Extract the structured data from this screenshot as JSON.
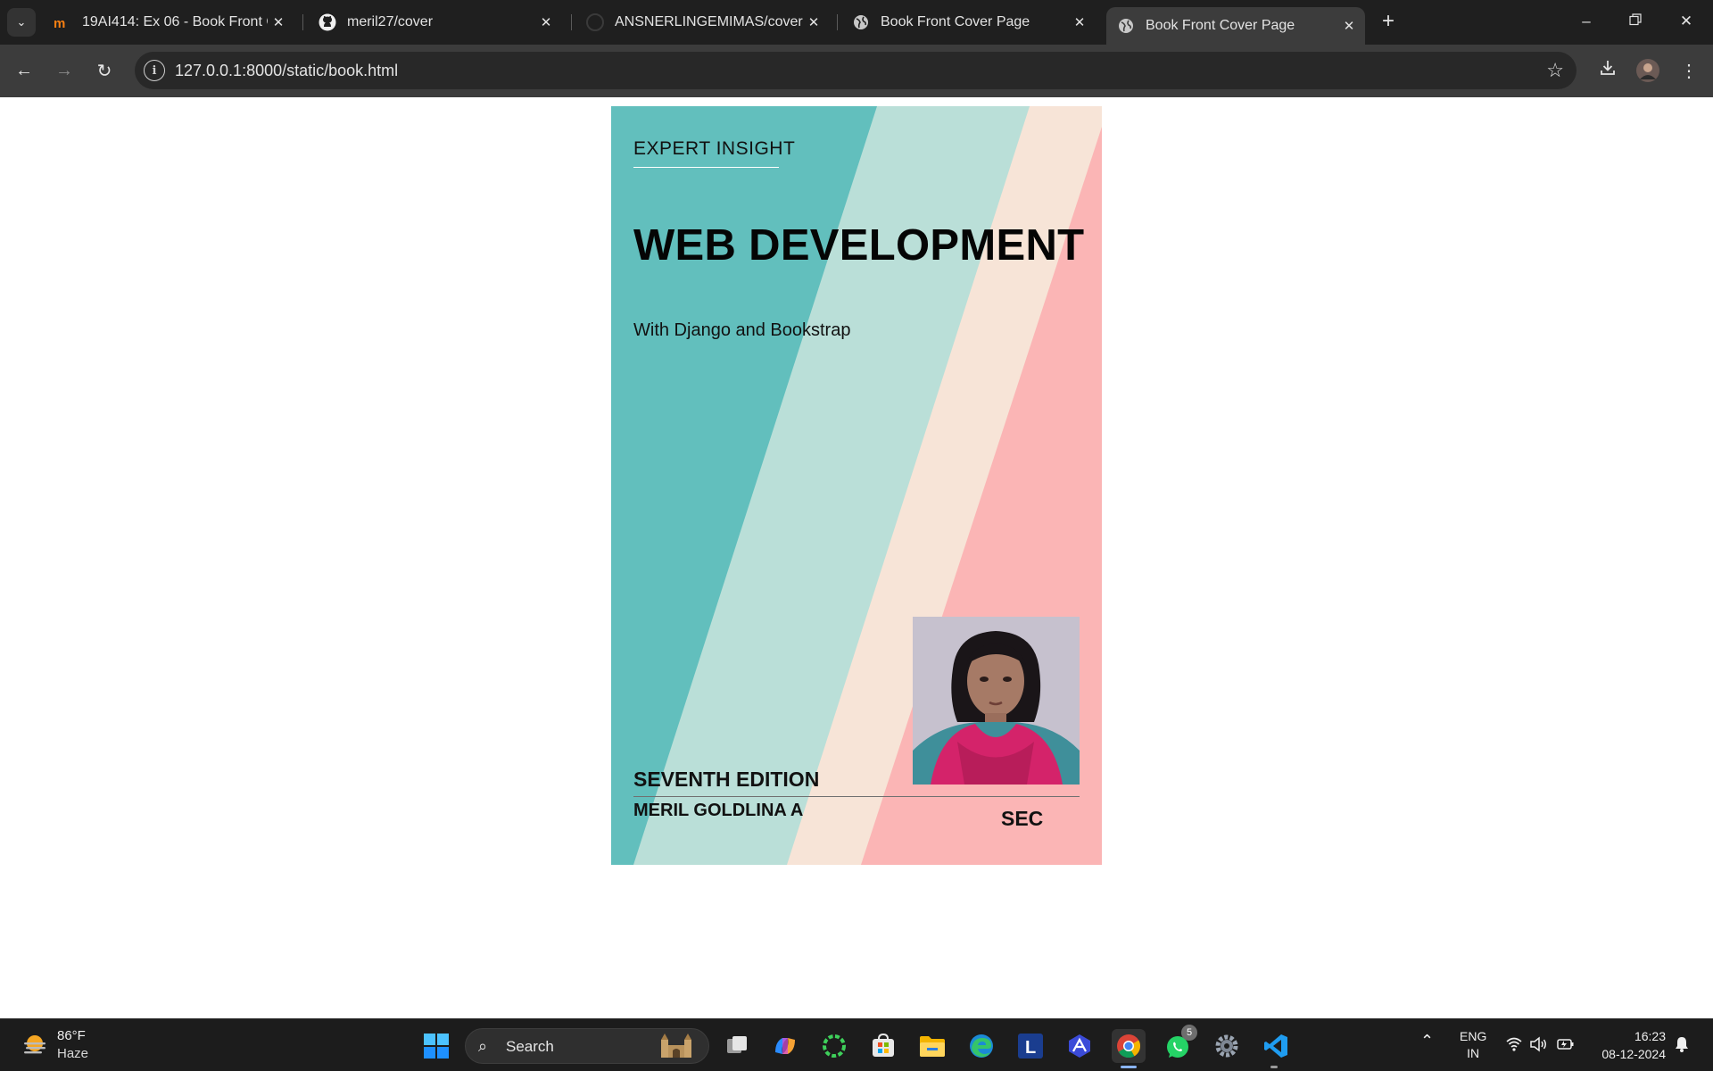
{
  "browser": {
    "tabs": [
      {
        "title": "19AI414: Ex 06 - Book Front Co",
        "favicon": "moodle-icon"
      },
      {
        "title": "meril27/cover",
        "favicon": "github-icon"
      },
      {
        "title": "ANSNERLINGEMIMAS/cover",
        "favicon": "github-icon"
      },
      {
        "title": "Book Front Cover Page",
        "favicon": "globe-icon"
      },
      {
        "title": "Book Front Cover Page",
        "favicon": "globe-icon",
        "active": true
      }
    ],
    "url": "127.0.0.1:8000/static/book.html"
  },
  "cover": {
    "series": "EXPERT INSIGHT",
    "title": "WEB DEVELOPMENT",
    "subtitle": "With Django and Bookstrap",
    "edition": "SEVENTH EDITION",
    "author": "MERIL GOLDLINA A",
    "publisher": "SEC",
    "colors": {
      "teal": "#62bfbd",
      "mint": "#badfd8",
      "peach": "#f7e4d7",
      "pink": "#fbb5b5"
    }
  },
  "taskbar": {
    "weather": {
      "temp": "86°F",
      "condition": "Haze"
    },
    "search_label": "Search",
    "apps": [
      "start-icon",
      "task-view-icon",
      "copilot-icon",
      "app-green-ring-icon",
      "microsoft-store-icon",
      "file-explorer-icon",
      "edge-icon",
      "l-app-icon",
      "vpn-app-icon",
      "chrome-icon",
      "whatsapp-icon",
      "settings-icon",
      "vscode-icon"
    ],
    "whatsapp_badge": "5",
    "language": {
      "line1": "ENG",
      "line2": "IN"
    },
    "clock": {
      "time": "16:23",
      "date": "08-12-2024"
    }
  }
}
